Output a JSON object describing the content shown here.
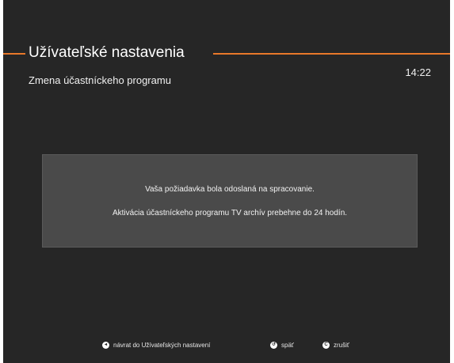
{
  "header": {
    "title": "Užívateľské nastavenia",
    "subtitle": "Zmena účastníckeho programu",
    "clock": "14:22",
    "accent_color": "#e8782a"
  },
  "message": {
    "line1": "Vaša požiadavka bola odoslaná na spracovanie.",
    "line2": "Aktivácia účastníckeho programu TV archív prebehne do 24 hodín."
  },
  "footer": {
    "hints": [
      {
        "icon": "back-to-settings-key-icon",
        "glyph": "◂",
        "label": "návrat do Užívateľských nastavení"
      },
      {
        "icon": "back-key-icon",
        "glyph": "↺",
        "label": "späť"
      },
      {
        "icon": "cancel-key-icon",
        "glyph": "C",
        "label": "zrušiť"
      }
    ]
  }
}
